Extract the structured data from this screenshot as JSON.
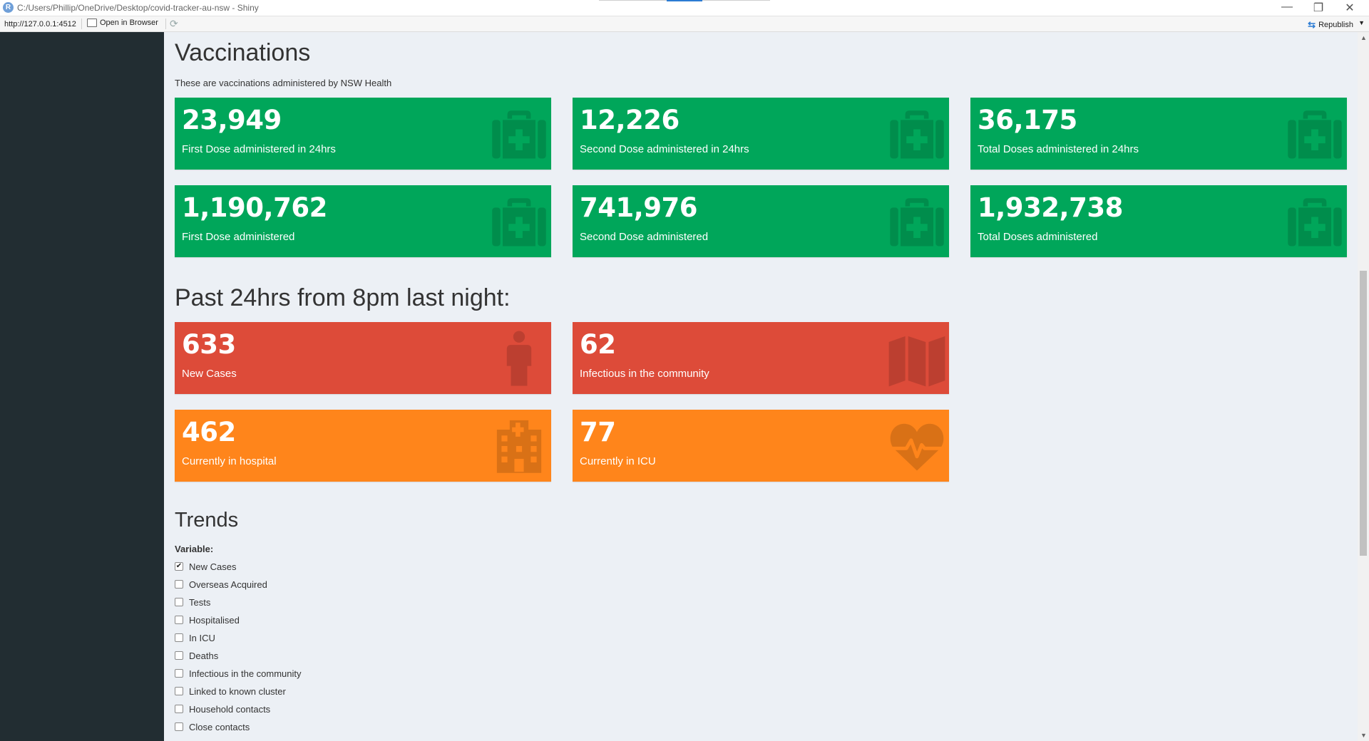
{
  "window": {
    "title": "C:/Users/Phillip/OneDrive/Desktop/covid-tracker-au-nsw - Shiny",
    "r_logo": "R",
    "minimize": "—",
    "restore": "❐",
    "close": "✕"
  },
  "toolbar": {
    "url": "http://127.0.0.1:4512",
    "open_in_browser": "Open in Browser",
    "republish": "Republish"
  },
  "vaccinations": {
    "heading": "Vaccinations",
    "subtitle": "These are vaccinations administered by NSW Health",
    "boxes": [
      {
        "value": "23,949",
        "label": "First Dose administered in 24hrs",
        "icon": "medkit-icon"
      },
      {
        "value": "12,226",
        "label": "Second Dose administered in 24hrs",
        "icon": "medkit-icon"
      },
      {
        "value": "36,175",
        "label": "Total Doses administered in 24hrs",
        "icon": "medkit-icon"
      },
      {
        "value": "1,190,762",
        "label": "First Dose administered",
        "icon": "medkit-icon"
      },
      {
        "value": "741,976",
        "label": "Second Dose administered",
        "icon": "medkit-icon"
      },
      {
        "value": "1,932,738",
        "label": "Total Doses administered",
        "icon": "medkit-icon"
      }
    ]
  },
  "past24": {
    "heading": "Past 24hrs from 8pm last night:",
    "boxes": [
      {
        "value": "633",
        "label": "New Cases",
        "icon": "person-icon"
      },
      {
        "value": "62",
        "label": "Infectious in the community",
        "icon": "map-icon"
      },
      {
        "value": "462",
        "label": "Currently in hospital",
        "icon": "hospital-icon"
      },
      {
        "value": "77",
        "label": "Currently in ICU",
        "icon": "heartbeat-icon"
      }
    ]
  },
  "trends": {
    "heading": "Trends",
    "variable_label": "Variable:",
    "options": [
      {
        "label": "New Cases",
        "checked": true
      },
      {
        "label": "Overseas Acquired",
        "checked": false
      },
      {
        "label": "Tests",
        "checked": false
      },
      {
        "label": "Hospitalised",
        "checked": false
      },
      {
        "label": "In ICU",
        "checked": false
      },
      {
        "label": "Deaths",
        "checked": false
      },
      {
        "label": "Infectious in the community",
        "checked": false
      },
      {
        "label": "Linked to known cluster",
        "checked": false
      },
      {
        "label": "Household contacts",
        "checked": false
      },
      {
        "label": "Close contacts",
        "checked": false
      }
    ]
  },
  "colors": {
    "green": "#00a65a",
    "red": "#dd4b39",
    "orange": "#ff851b",
    "sidebar": "#222d32",
    "content_bg": "#ecf0f5"
  }
}
